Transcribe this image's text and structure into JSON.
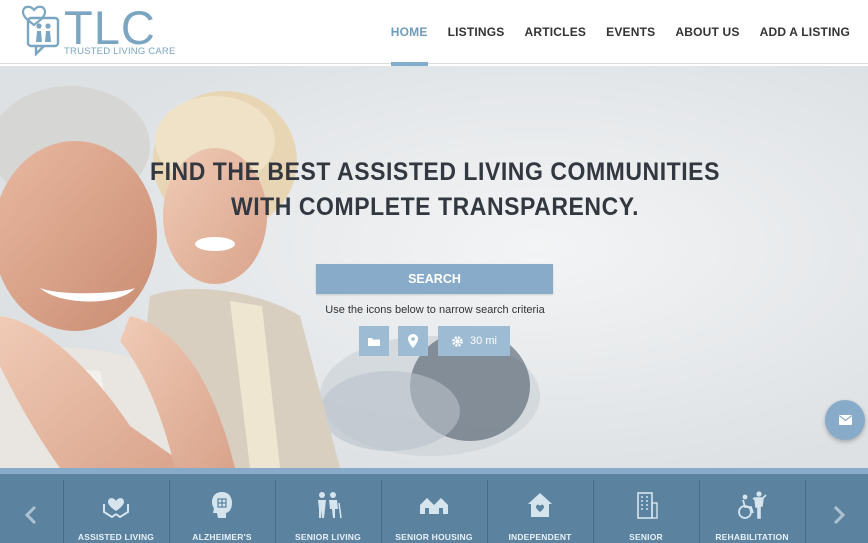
{
  "header": {
    "logo_title": "TLC",
    "logo_subtitle": "TRUSTED LIVING CARE",
    "nav": [
      {
        "label": "HOME",
        "active": true
      },
      {
        "label": "LISTINGS",
        "active": false
      },
      {
        "label": "ARTICLES",
        "active": false
      },
      {
        "label": "EVENTS",
        "active": false
      },
      {
        "label": "ABOUT US",
        "active": false
      },
      {
        "label": "ADD A LISTING",
        "active": false
      }
    ]
  },
  "hero": {
    "headline_line1": "FIND THE BEST ASSISTED LIVING COMMUNITIES",
    "headline_line2": "WITH COMPLETE TRANSPARENCY.",
    "search_label": "SEARCH",
    "hint": "Use the icons below to narrow search criteria",
    "filters": {
      "category_icon": "folder-icon",
      "location_icon": "map-pin-icon",
      "radius_icon": "gear-icon",
      "radius_value": "30 mi"
    },
    "contact_icon": "envelope-icon"
  },
  "categories": {
    "prev_icon": "chevron-left-icon",
    "next_icon": "chevron-right-icon",
    "items": [
      {
        "label": "ASSISTED LIVING",
        "icon": "heart-hands-icon"
      },
      {
        "label": "ALZHEIMER'S",
        "icon": "head-puzzle-icon"
      },
      {
        "label": "SENIOR LIVING",
        "icon": "elderly-couple-icon"
      },
      {
        "label": "SENIOR HOUSING",
        "icon": "houses-icon"
      },
      {
        "label": "INDEPENDENT",
        "icon": "house-heart-icon"
      },
      {
        "label": "SENIOR",
        "icon": "building-icon"
      },
      {
        "label": "REHABILITATION",
        "icon": "wheelchair-icon"
      }
    ]
  },
  "colors": {
    "accent": "#87abc9",
    "nav_active": "#6c9bbd",
    "category_bar": "#5b83a0"
  }
}
